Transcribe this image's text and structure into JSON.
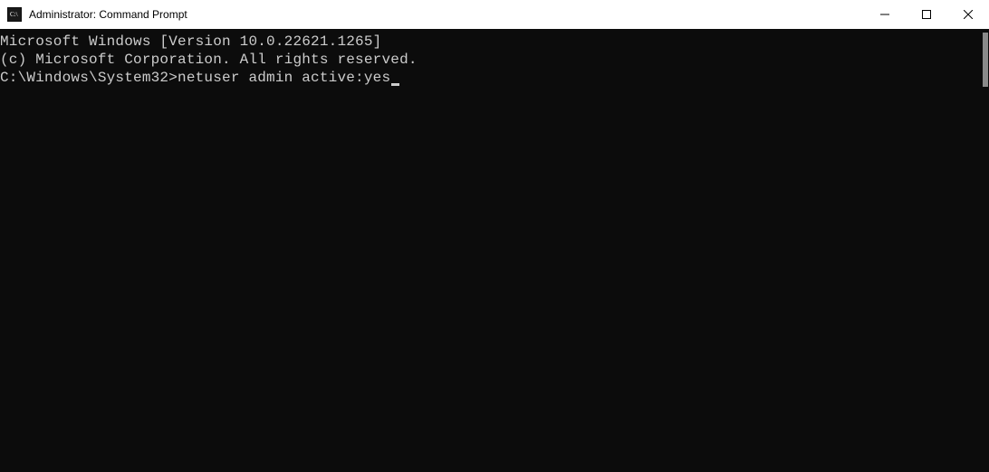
{
  "window": {
    "title": "Administrator: Command Prompt"
  },
  "terminal": {
    "line1": "Microsoft Windows [Version 10.0.22621.1265]",
    "line2": "(c) Microsoft Corporation. All rights reserved.",
    "blank": "",
    "prompt": "C:\\Windows\\System32>",
    "command": "netuser admin active:yes"
  }
}
